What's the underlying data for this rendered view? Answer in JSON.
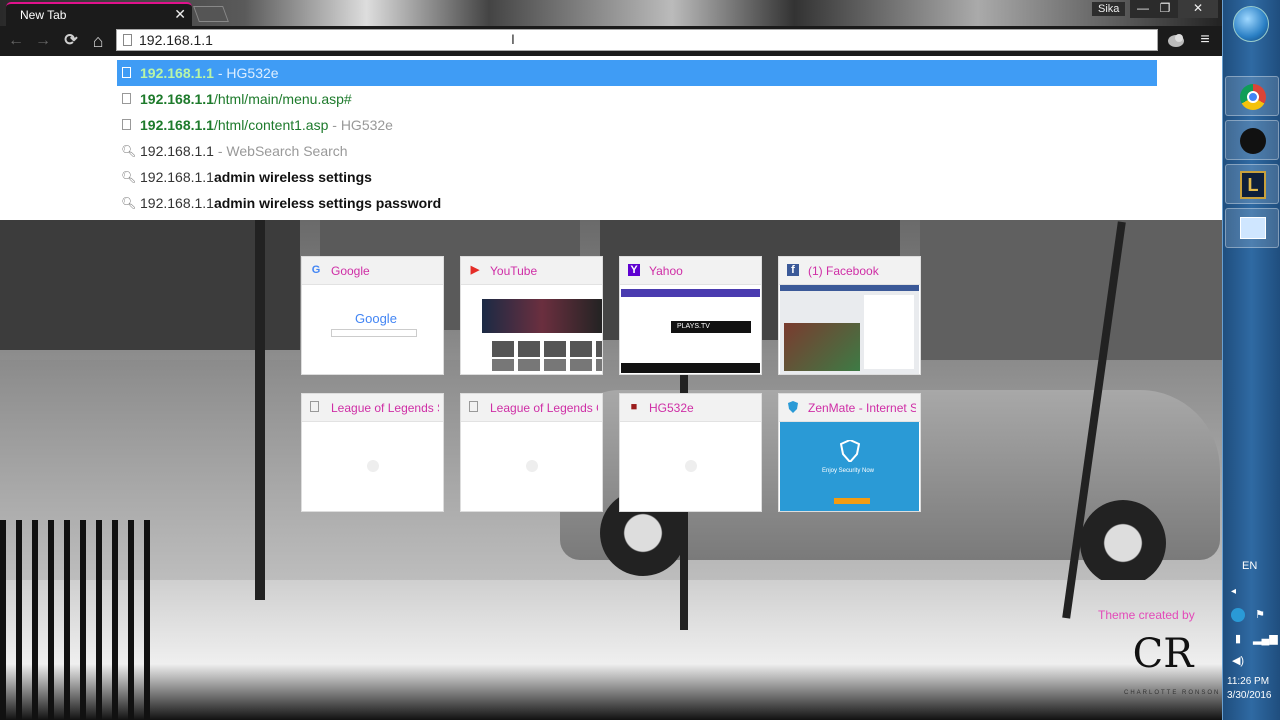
{
  "browser": {
    "tab": {
      "title": "New Tab",
      "close": "✕"
    },
    "profile_name": "Sika",
    "window_controls": {
      "minimize": "—",
      "restore": "❐",
      "close": "✕"
    }
  },
  "toolbar": {
    "back": "←",
    "forward": "→",
    "reload": "⟳",
    "home": "⌂",
    "menu": "≡",
    "address_value": "192.168.1.1"
  },
  "suggestions": [
    {
      "bold": "192.168.1.1",
      "rest": "",
      "sep": " - HG532e",
      "type": "page",
      "selected": true
    },
    {
      "bold": "192.168.1.1",
      "rest": "/html/main/menu.asp#",
      "sep": "",
      "type": "page"
    },
    {
      "bold": "192.168.1.1",
      "rest": "/html/content1.asp",
      "sep": " - HG532e",
      "type": "page"
    },
    {
      "plain": "192.168.1.1",
      "sep": " - WebSearch Search",
      "type": "search"
    },
    {
      "plain": "192.168.1.1",
      "suffix": "admin wireless settings",
      "type": "search"
    },
    {
      "plain": "192.168.1.1",
      "suffix": "admin wireless settings password",
      "type": "search"
    }
  ],
  "most_visited": [
    {
      "title": "Google",
      "favicon": "G",
      "favicon_color": "#4285f4"
    },
    {
      "title": "YouTube",
      "favicon": "▶",
      "favicon_color": "#e52d27"
    },
    {
      "title": "Yahoo",
      "favicon": "Y",
      "favicon_color": "#5f01d1"
    },
    {
      "title": "(1) Facebook",
      "favicon": "f",
      "favicon_color": "#3b5998"
    },
    {
      "title": "League of Legends S",
      "favicon": "page-icon"
    },
    {
      "title": "League of Legends O",
      "favicon": "page-icon"
    },
    {
      "title": "HG532e",
      "favicon": "■",
      "favicon_color": "#9b1c1c"
    },
    {
      "title": "ZenMate - Internet Se",
      "favicon": "shield-icon",
      "favicon_color": "#2a9ad6"
    }
  ],
  "thumbnail_text": {
    "google_logo": "Google",
    "plays_tv": "PLAYS.TV",
    "zenmate_caption": "Enjoy Security Now"
  },
  "theme_credit": "Theme created by",
  "theme_logo": "CR",
  "theme_logo_sub": "CHARLOTTE RONSON",
  "taskbar": {
    "language": "EN",
    "time": "11:26 PM",
    "date": "3/30/2016"
  },
  "colors": {
    "tab_accent": "#e0128c",
    "selection_blue": "#3f9cf5",
    "url_green": "#1d7a2b",
    "tile_title_pink": "#cf2ea6",
    "taskbar_blue": "#2f6aa3"
  }
}
